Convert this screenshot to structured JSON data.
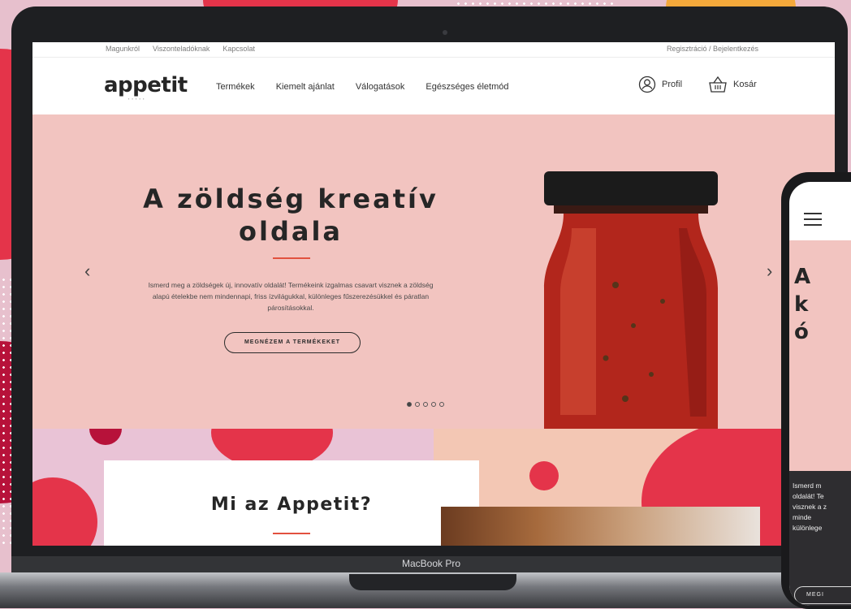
{
  "topbar": {
    "links": [
      "Magunkról",
      "Viszonteladóknak",
      "Kapcsolat"
    ],
    "auth": "Regisztráció / Bejelentkezés"
  },
  "nav": {
    "logo": "appetit",
    "menu": [
      "Termékek",
      "Kiemelt ajánlat",
      "Válogatások",
      "Egészséges életmód"
    ],
    "profile_label": "Profil",
    "cart_label": "Kosár"
  },
  "hero": {
    "title_line1": "A zöldség kreatív",
    "title_line2": "oldala",
    "text": "Ismerd meg a zöldségek új, innovatív oldalát! Termékeink izgalmas csavart visznek a zöldség alapú ételekbe nem mindennapi, friss ízvilágukkal, különleges fűszerezésükkel és páratlan párosításokkal.",
    "button": "MEGNÉZEM A TERMÉKEKET",
    "slide_count": 5,
    "active_slide": 1
  },
  "section": {
    "title": "Mi az Appetit?"
  },
  "laptop": {
    "label": "MacBook Pro"
  },
  "phone": {
    "title_visible": "A\nk\nó",
    "text_visible": "Ismerd m\noldalát! Te\nvisznek a z\nminde\nkülönlege",
    "button_visible": "MEGI"
  },
  "colors": {
    "hero_bg": "#f2c4c0",
    "accent": "#e2513f",
    "dark": "#262626"
  }
}
